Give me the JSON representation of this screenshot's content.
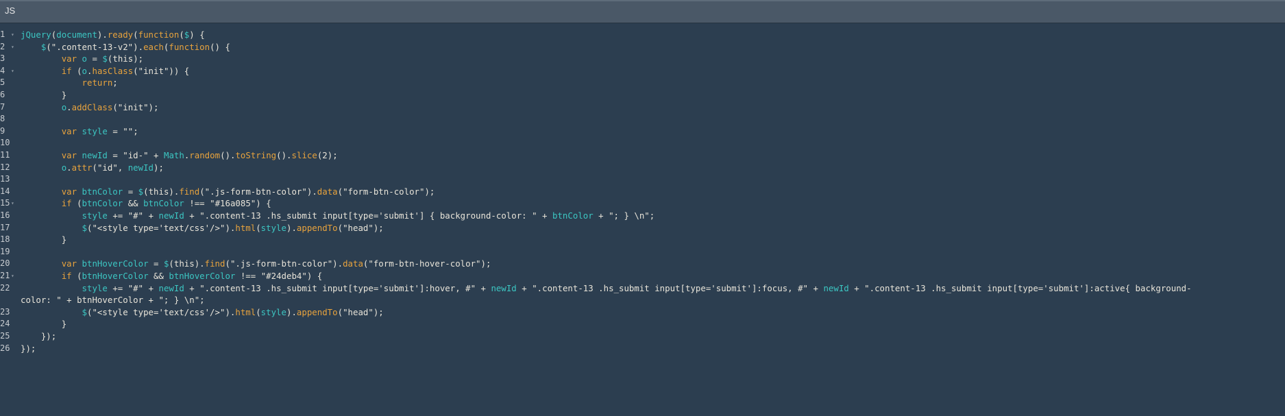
{
  "panel": {
    "title": "JS"
  },
  "editor": {
    "lines": [
      {
        "n": "1",
        "fold": "▾",
        "text": "jQuery(document).ready(function($) {"
      },
      {
        "n": "2",
        "fold": "▾",
        "text": "    $(\".content-13-v2\").each(function() {"
      },
      {
        "n": "3",
        "fold": "",
        "text": "        var o = $(this);"
      },
      {
        "n": "4",
        "fold": "▾",
        "text": "        if (o.hasClass(\"init\")) {"
      },
      {
        "n": "5",
        "fold": "",
        "text": "            return;"
      },
      {
        "n": "6",
        "fold": "",
        "text": "        }"
      },
      {
        "n": "7",
        "fold": "",
        "text": "        o.addClass(\"init\");"
      },
      {
        "n": "8",
        "fold": "",
        "text": ""
      },
      {
        "n": "9",
        "fold": "",
        "text": "        var style = \"\";"
      },
      {
        "n": "10",
        "fold": "",
        "text": ""
      },
      {
        "n": "11",
        "fold": "",
        "text": "        var newId = \"id-\" + Math.random().toString().slice(2);"
      },
      {
        "n": "12",
        "fold": "",
        "text": "        o.attr(\"id\", newId);"
      },
      {
        "n": "13",
        "fold": "",
        "text": ""
      },
      {
        "n": "14",
        "fold": "",
        "text": "        var btnColor = $(this).find(\".js-form-btn-color\").data(\"form-btn-color\");"
      },
      {
        "n": "15",
        "fold": "▾",
        "text": "        if (btnColor && btnColor !== \"#16a085\") {"
      },
      {
        "n": "16",
        "fold": "",
        "text": "            style += \"#\" + newId + \".content-13 .hs_submit input[type='submit'] { background-color: \" + btnColor + \"; } \\n\";"
      },
      {
        "n": "17",
        "fold": "",
        "text": "            $(\"<style type='text/css'/>\").html(style).appendTo(\"head\");"
      },
      {
        "n": "18",
        "fold": "",
        "text": "        }"
      },
      {
        "n": "19",
        "fold": "",
        "text": ""
      },
      {
        "n": "20",
        "fold": "",
        "text": "        var btnHoverColor = $(this).find(\".js-form-btn-color\").data(\"form-btn-hover-color\");"
      },
      {
        "n": "21",
        "fold": "▾",
        "text": "        if (btnHoverColor && btnHoverColor !== \"#24deb4\") {"
      },
      {
        "n": "22",
        "fold": "",
        "text": "            style += \"#\" + newId + \".content-13 .hs_submit input[type='submit']:hover, #\" + newId + \".content-13 .hs_submit input[type='submit']:focus, #\" + newId + \".content-13 .hs_submit input[type='submit']:active{ background-"
      },
      {
        "n": "",
        "fold": "",
        "text": "color: \" + btnHoverColor + \"; } \\n\";"
      },
      {
        "n": "23",
        "fold": "",
        "text": "            $(\"<style type='text/css'/>\").html(style).appendTo(\"head\");"
      },
      {
        "n": "24",
        "fold": "",
        "text": "        }"
      },
      {
        "n": "25",
        "fold": "",
        "text": "    });"
      },
      {
        "n": "26",
        "fold": "",
        "text": "});"
      }
    ]
  },
  "colors": {
    "background": "#2c3e50",
    "header": "#4a5867",
    "text": "#e8e4d9",
    "keyword": "#e8a33d",
    "string": "#e8e4d9",
    "identifier": "#3cc6c2",
    "line_number": "#c8ccd0"
  }
}
